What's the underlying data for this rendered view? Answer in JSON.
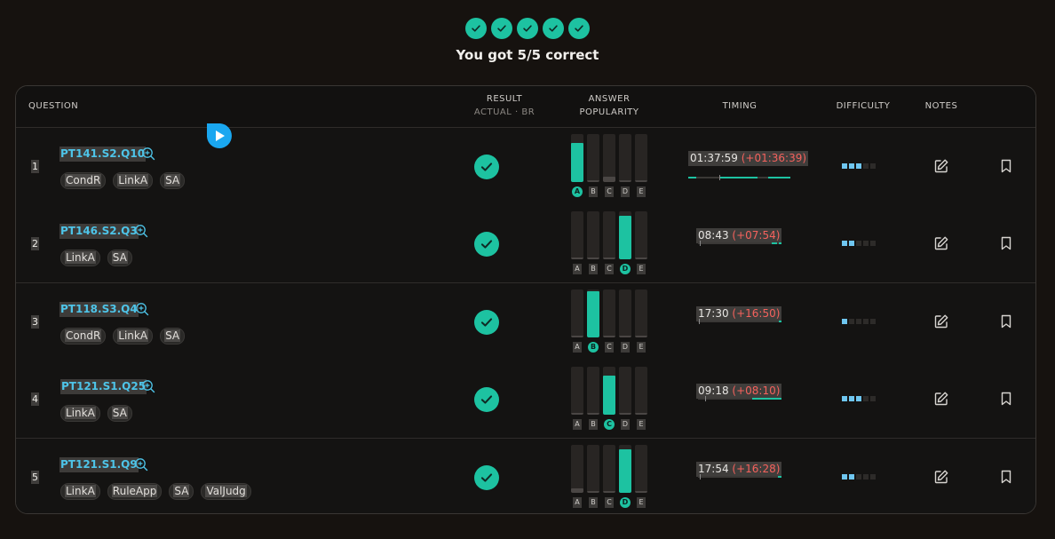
{
  "header": {
    "checks": [
      true,
      true,
      true,
      true,
      true
    ],
    "score_text": "You got 5/5 correct"
  },
  "table": {
    "columns": {
      "question": "QUESTION",
      "result": "RESULT",
      "result_sub": "ACTUAL · BR",
      "answer": "ANSWER",
      "popularity": "POPULARITY",
      "timing": "TIMING",
      "difficulty": "DIFFICULTY",
      "notes": "NOTES"
    },
    "choice_letters": [
      "A",
      "B",
      "C",
      "D",
      "E"
    ],
    "rows": [
      {
        "num": "1",
        "id": "PT141.S2.Q10",
        "tags": [
          "CondR",
          "LinkA",
          "SA"
        ],
        "correct": true,
        "popularity": [
          0.82,
          0,
          0.12,
          0,
          0
        ],
        "answer_index": 0,
        "time": "01:37:59",
        "delta": "(+01:36:39)",
        "difficulty": 3
      },
      {
        "num": "2",
        "id": "PT146.S2.Q3",
        "tags": [
          "LinkA",
          "SA"
        ],
        "correct": true,
        "popularity": [
          0,
          0,
          0,
          0.92,
          0
        ],
        "answer_index": 3,
        "time": "08:43",
        "delta": "(+07:54)",
        "difficulty": 2
      },
      {
        "num": "3",
        "id": "PT118.S3.Q4",
        "tags": [
          "CondR",
          "LinkA",
          "SA"
        ],
        "correct": true,
        "popularity": [
          0,
          0.96,
          0,
          0,
          0
        ],
        "answer_index": 1,
        "time": "17:30",
        "delta": "(+16:50)",
        "difficulty": 1
      },
      {
        "num": "4",
        "id": "PT121.S1.Q25",
        "tags": [
          "LinkA",
          "SA"
        ],
        "correct": true,
        "popularity": [
          0,
          0,
          0.82,
          0,
          0
        ],
        "answer_index": 2,
        "time": "09:18",
        "delta": "(+08:10)",
        "difficulty": 3
      },
      {
        "num": "5",
        "id": "PT121.S1.Q9",
        "tags": [
          "LinkA",
          "RuleApp",
          "SA",
          "ValJudg"
        ],
        "correct": true,
        "popularity": [
          0.08,
          0,
          0,
          0.9,
          0
        ],
        "answer_index": 3,
        "time": "17:54",
        "delta": "(+16:28)",
        "difficulty": 2
      }
    ]
  },
  "colors": {
    "accent": "#1dc2a1",
    "link": "#4ec4e8",
    "delta": "#f5625d",
    "difficulty": "#6fc6f0",
    "background": "#16120f"
  },
  "icons": {
    "check": "check-icon",
    "zoom": "zoom-in-icon",
    "notes": "edit-note-icon",
    "bookmark": "bookmark-icon",
    "cursor": "play-cursor-icon"
  }
}
